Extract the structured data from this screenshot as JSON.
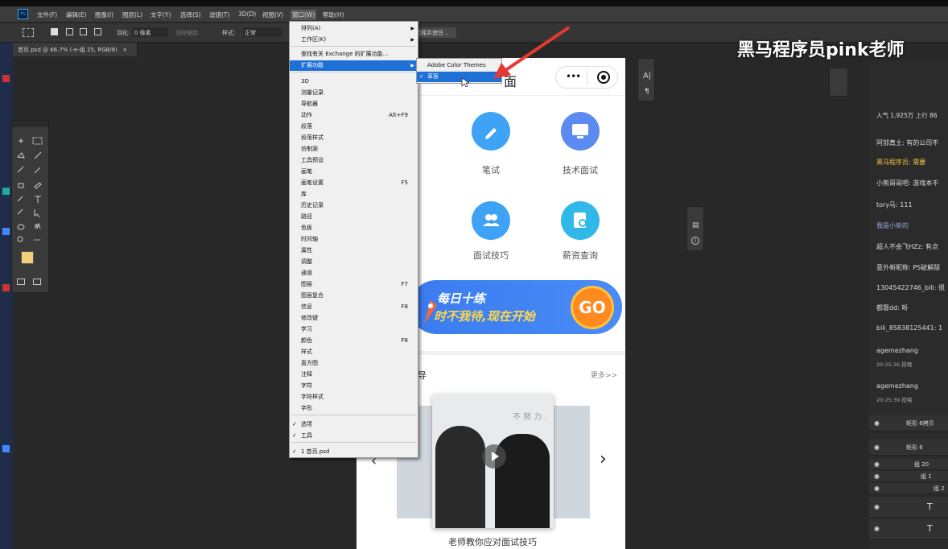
{
  "menubar": {
    "items": [
      "文件(F)",
      "编辑(E)",
      "图像(I)",
      "图层(L)",
      "文字(Y)",
      "选择(S)",
      "滤镜(T)",
      "3D(D)",
      "视图(V)",
      "窗口(W)",
      "帮助(H)"
    ],
    "active": "窗口(W)"
  },
  "optbar": {
    "feather_label": "羽化:",
    "feather_value": "0 像素",
    "antialias": "消除锯齿",
    "style_label": "样式:",
    "style_value": "正常",
    "select_mask": "选择并遮住..."
  },
  "doc_tab": {
    "title": "首页.psd @ 66.7% (-e-组 25, RGB/8)"
  },
  "window_menu": {
    "items": [
      {
        "label": "排列(A)",
        "arrow": true
      },
      {
        "label": "工作区(K)",
        "arrow": true
      },
      {
        "label": "查找有关 Exchange 的扩展功能..."
      },
      {
        "label": "扩展功能",
        "arrow": true,
        "highlighted": true
      },
      {
        "label": "3D"
      },
      {
        "label": "测量记录"
      },
      {
        "label": "导航器"
      },
      {
        "label": "动作",
        "shortcut": "Alt+F9"
      },
      {
        "label": "段落"
      },
      {
        "label": "段落样式"
      },
      {
        "label": "仿制源"
      },
      {
        "label": "工具预设"
      },
      {
        "label": "画笔"
      },
      {
        "label": "画笔设置",
        "shortcut": "F5"
      },
      {
        "label": "库"
      },
      {
        "label": "历史记录"
      },
      {
        "label": "路径"
      },
      {
        "label": "色板"
      },
      {
        "label": "时间轴"
      },
      {
        "label": "属性"
      },
      {
        "label": "调整"
      },
      {
        "label": "通道"
      },
      {
        "label": "图层",
        "shortcut": "F7"
      },
      {
        "label": "图层复合"
      },
      {
        "label": "信息",
        "shortcut": "F8"
      },
      {
        "label": "修改键"
      },
      {
        "label": "学习"
      },
      {
        "label": "颜色",
        "shortcut": "F6"
      },
      {
        "label": "样式"
      },
      {
        "label": "直方图"
      },
      {
        "label": "注释"
      },
      {
        "label": "字符"
      },
      {
        "label": "字符样式"
      },
      {
        "label": "字形"
      },
      {
        "label": "选项",
        "checked": true
      },
      {
        "label": "工具",
        "checked": true
      },
      {
        "label": "1 首页.psd",
        "checked": true
      }
    ]
  },
  "ext_submenu": {
    "items": [
      {
        "label": "Adobe Color Themes"
      },
      {
        "label": "草客",
        "checked": true
      }
    ]
  },
  "canvas": {
    "title_tail": "面",
    "icons": [
      {
        "label": "笔试",
        "color": "#3fa3f5"
      },
      {
        "label": "技术面试",
        "color": "#5b8af0"
      },
      {
        "label": "面试技巧",
        "color": "#3fa3f5"
      },
      {
        "label": "薪资查询",
        "color": "#30b8e8"
      }
    ],
    "banner": {
      "line1": "每日十练",
      "line2": "时不我待,现在开始",
      "go": "GO"
    },
    "section_tail": "导",
    "more": "更多>>",
    "video_caption": "老师教你应对面试技巧",
    "video_bg_text": "不 努 力 ."
  },
  "watermark": "黑马程序员pink老师",
  "chat": {
    "stats": "人气 1,925万 上行 86",
    "messages": [
      "阿部真土: 有的公司不",
      "黑马程序员: 需要",
      "小熊哥哥吧: 游戏本不",
      "tory马: 111",
      "我是小新的",
      "超人不会飞HZz: 有点",
      "意外新昵称: PS破解版",
      "13045422746_bili: 很",
      "都督dd: 听",
      "bili_85838125441: 1",
      "agemezhang",
      "20:25:36 投喂",
      "agemezhang",
      "20:25:39 投喂"
    ]
  },
  "layers": [
    {
      "name": "矩形 6拷贝"
    },
    {
      "name": "矩形 6"
    },
    {
      "name": "组 20"
    },
    {
      "name": "组 1"
    },
    {
      "name": "组 2"
    }
  ],
  "colors": {
    "menu_highlight": "#1e6fd6",
    "foreground": "#f2cf7a",
    "background": "#ffffff"
  }
}
